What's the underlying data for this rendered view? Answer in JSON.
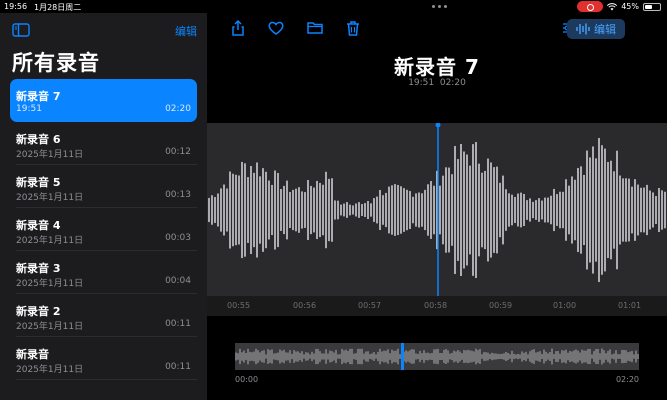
{
  "status": {
    "time": "19:56",
    "date": "1月28日周二",
    "battery": "45%"
  },
  "sidebar": {
    "edit_label": "编辑",
    "title": "所有录音",
    "items": [
      {
        "name": "新录音 7",
        "date": "19:51",
        "duration": "02:20",
        "selected": true
      },
      {
        "name": "新录音 6",
        "date": "2025年1月11日",
        "duration": "00:12"
      },
      {
        "name": "新录音 5",
        "date": "2025年1月11日",
        "duration": "00:13"
      },
      {
        "name": "新录音 4",
        "date": "2025年1月11日",
        "duration": "00:03"
      },
      {
        "name": "新录音 3",
        "date": "2025年1月11日",
        "duration": "00:04"
      },
      {
        "name": "新录音 2",
        "date": "2025年1月11日",
        "duration": "00:11"
      },
      {
        "name": "新录音",
        "date": "2025年1月11日",
        "duration": "00:11"
      }
    ]
  },
  "main": {
    "edit_label": "编辑",
    "title": "新录音 7",
    "meta_time": "19:51",
    "meta_duration": "02:20",
    "timeline_ticks": [
      "00:55",
      "00:56",
      "00:57",
      "00:58",
      "00:59",
      "01:00",
      "01:01"
    ],
    "overview_start": "00:00",
    "overview_end": "02:20"
  },
  "colors": {
    "accent": "#0a84ff",
    "sidebar_bg": "#1c1c1e",
    "wave_bg": "#2a2a2c"
  },
  "icons": {
    "toolbar": [
      "share-icon",
      "heart-icon",
      "folder-icon",
      "trash-icon",
      "options-sliders-icon",
      "waveform-icon"
    ],
    "sidebar_toggle": "sidebar-icon"
  }
}
